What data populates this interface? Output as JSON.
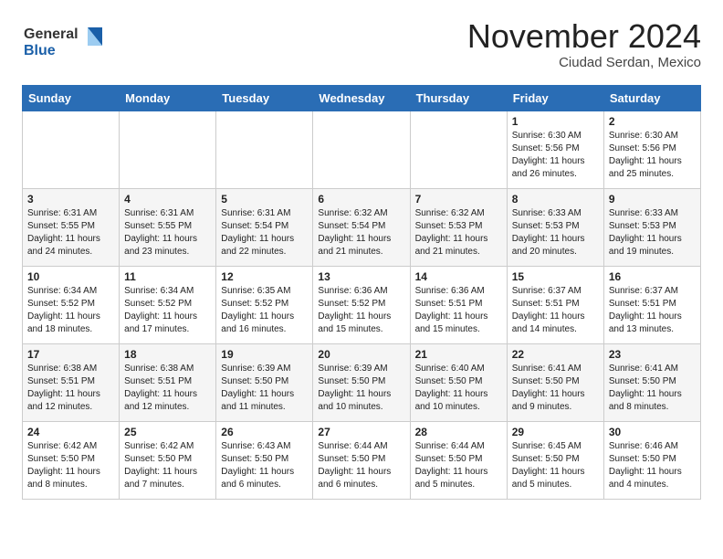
{
  "header": {
    "logo_line1": "General",
    "logo_line2": "Blue",
    "month_title": "November 2024",
    "location": "Ciudad Serdan, Mexico"
  },
  "days_of_week": [
    "Sunday",
    "Monday",
    "Tuesday",
    "Wednesday",
    "Thursday",
    "Friday",
    "Saturday"
  ],
  "weeks": [
    [
      {
        "day": "",
        "info": ""
      },
      {
        "day": "",
        "info": ""
      },
      {
        "day": "",
        "info": ""
      },
      {
        "day": "",
        "info": ""
      },
      {
        "day": "",
        "info": ""
      },
      {
        "day": "1",
        "info": "Sunrise: 6:30 AM\nSunset: 5:56 PM\nDaylight: 11 hours\nand 26 minutes."
      },
      {
        "day": "2",
        "info": "Sunrise: 6:30 AM\nSunset: 5:56 PM\nDaylight: 11 hours\nand 25 minutes."
      }
    ],
    [
      {
        "day": "3",
        "info": "Sunrise: 6:31 AM\nSunset: 5:55 PM\nDaylight: 11 hours\nand 24 minutes."
      },
      {
        "day": "4",
        "info": "Sunrise: 6:31 AM\nSunset: 5:55 PM\nDaylight: 11 hours\nand 23 minutes."
      },
      {
        "day": "5",
        "info": "Sunrise: 6:31 AM\nSunset: 5:54 PM\nDaylight: 11 hours\nand 22 minutes."
      },
      {
        "day": "6",
        "info": "Sunrise: 6:32 AM\nSunset: 5:54 PM\nDaylight: 11 hours\nand 21 minutes."
      },
      {
        "day": "7",
        "info": "Sunrise: 6:32 AM\nSunset: 5:53 PM\nDaylight: 11 hours\nand 21 minutes."
      },
      {
        "day": "8",
        "info": "Sunrise: 6:33 AM\nSunset: 5:53 PM\nDaylight: 11 hours\nand 20 minutes."
      },
      {
        "day": "9",
        "info": "Sunrise: 6:33 AM\nSunset: 5:53 PM\nDaylight: 11 hours\nand 19 minutes."
      }
    ],
    [
      {
        "day": "10",
        "info": "Sunrise: 6:34 AM\nSunset: 5:52 PM\nDaylight: 11 hours\nand 18 minutes."
      },
      {
        "day": "11",
        "info": "Sunrise: 6:34 AM\nSunset: 5:52 PM\nDaylight: 11 hours\nand 17 minutes."
      },
      {
        "day": "12",
        "info": "Sunrise: 6:35 AM\nSunset: 5:52 PM\nDaylight: 11 hours\nand 16 minutes."
      },
      {
        "day": "13",
        "info": "Sunrise: 6:36 AM\nSunset: 5:52 PM\nDaylight: 11 hours\nand 15 minutes."
      },
      {
        "day": "14",
        "info": "Sunrise: 6:36 AM\nSunset: 5:51 PM\nDaylight: 11 hours\nand 15 minutes."
      },
      {
        "day": "15",
        "info": "Sunrise: 6:37 AM\nSunset: 5:51 PM\nDaylight: 11 hours\nand 14 minutes."
      },
      {
        "day": "16",
        "info": "Sunrise: 6:37 AM\nSunset: 5:51 PM\nDaylight: 11 hours\nand 13 minutes."
      }
    ],
    [
      {
        "day": "17",
        "info": "Sunrise: 6:38 AM\nSunset: 5:51 PM\nDaylight: 11 hours\nand 12 minutes."
      },
      {
        "day": "18",
        "info": "Sunrise: 6:38 AM\nSunset: 5:51 PM\nDaylight: 11 hours\nand 12 minutes."
      },
      {
        "day": "19",
        "info": "Sunrise: 6:39 AM\nSunset: 5:50 PM\nDaylight: 11 hours\nand 11 minutes."
      },
      {
        "day": "20",
        "info": "Sunrise: 6:39 AM\nSunset: 5:50 PM\nDaylight: 11 hours\nand 10 minutes."
      },
      {
        "day": "21",
        "info": "Sunrise: 6:40 AM\nSunset: 5:50 PM\nDaylight: 11 hours\nand 10 minutes."
      },
      {
        "day": "22",
        "info": "Sunrise: 6:41 AM\nSunset: 5:50 PM\nDaylight: 11 hours\nand 9 minutes."
      },
      {
        "day": "23",
        "info": "Sunrise: 6:41 AM\nSunset: 5:50 PM\nDaylight: 11 hours\nand 8 minutes."
      }
    ],
    [
      {
        "day": "24",
        "info": "Sunrise: 6:42 AM\nSunset: 5:50 PM\nDaylight: 11 hours\nand 8 minutes."
      },
      {
        "day": "25",
        "info": "Sunrise: 6:42 AM\nSunset: 5:50 PM\nDaylight: 11 hours\nand 7 minutes."
      },
      {
        "day": "26",
        "info": "Sunrise: 6:43 AM\nSunset: 5:50 PM\nDaylight: 11 hours\nand 6 minutes."
      },
      {
        "day": "27",
        "info": "Sunrise: 6:44 AM\nSunset: 5:50 PM\nDaylight: 11 hours\nand 6 minutes."
      },
      {
        "day": "28",
        "info": "Sunrise: 6:44 AM\nSunset: 5:50 PM\nDaylight: 11 hours\nand 5 minutes."
      },
      {
        "day": "29",
        "info": "Sunrise: 6:45 AM\nSunset: 5:50 PM\nDaylight: 11 hours\nand 5 minutes."
      },
      {
        "day": "30",
        "info": "Sunrise: 6:46 AM\nSunset: 5:50 PM\nDaylight: 11 hours\nand 4 minutes."
      }
    ]
  ]
}
